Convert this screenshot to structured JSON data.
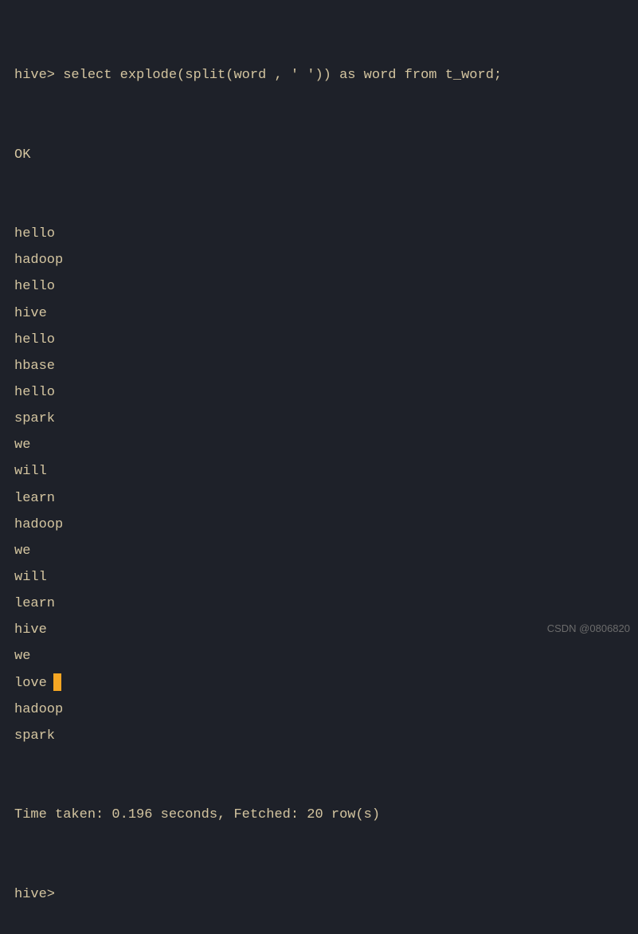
{
  "terminal": {
    "prompt": "hive>",
    "command": " select explode(split(word , ' ')) as word from t_word;",
    "status": "OK",
    "results": [
      "hello",
      "hadoop",
      "hello",
      "hive",
      "hello",
      "hbase",
      "hello",
      "spark",
      "we",
      "will",
      "learn",
      "hadoop",
      "we",
      "will",
      "learn",
      "hive",
      "we",
      "love",
      "hadoop",
      "spark"
    ],
    "cursor_row_index": 17,
    "timing": "Time taken: 0.196 seconds, Fetched: 20 row(s)",
    "next_prompt": "hive>"
  },
  "watermark": "CSDN @0806820"
}
